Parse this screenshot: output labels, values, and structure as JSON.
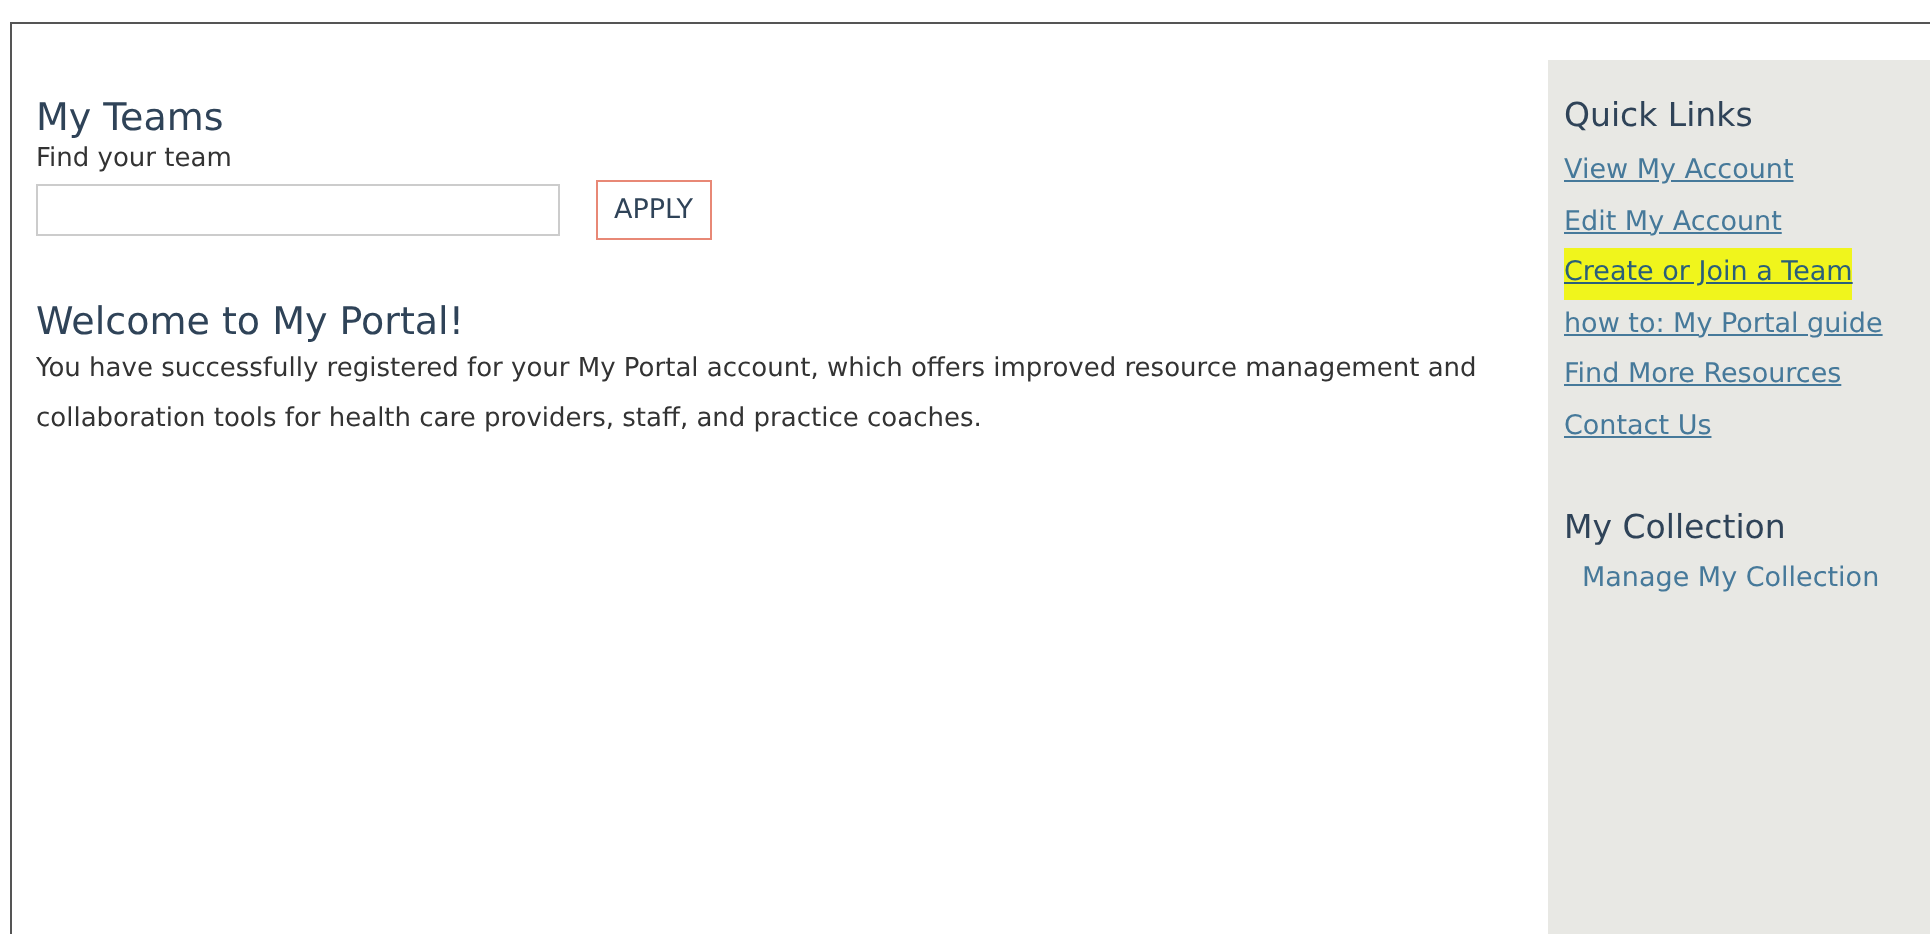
{
  "teams": {
    "title": "My Teams",
    "label": "Find your team",
    "button": "APPLY"
  },
  "welcome": {
    "title": "Welcome to My Portal!",
    "text": "You have successfully registered for your My Portal account, which offers improved resource management and collaboration tools for health care providers, staff, and practice coaches."
  },
  "quick_links": {
    "title": "Quick Links",
    "items": [
      {
        "label": "View My Account",
        "highlighted": false
      },
      {
        "label": "Edit My Account",
        "highlighted": false
      },
      {
        "label": "Create or Join a Team",
        "highlighted": true
      },
      {
        "label": "how to: My Portal guide",
        "highlighted": false
      },
      {
        "label": "Find More Resources",
        "highlighted": false
      },
      {
        "label": "Contact Us",
        "highlighted": false
      }
    ]
  },
  "collection": {
    "title": "My Collection",
    "items": [
      "Manage My Collection"
    ]
  }
}
